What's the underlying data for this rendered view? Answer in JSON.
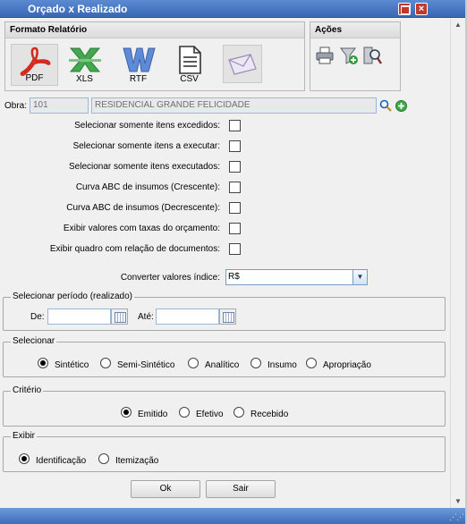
{
  "window": {
    "title": "Orçado x Realizado"
  },
  "format_panel": {
    "title": "Formato Relatório",
    "buttons": [
      {
        "label": "PDF",
        "icon": "pdf-icon"
      },
      {
        "label": "XLS",
        "icon": "excel-icon"
      },
      {
        "label": "RTF",
        "icon": "word-icon"
      },
      {
        "label": "CSV",
        "icon": "csv-file-icon"
      },
      {
        "label": "",
        "icon": "email-icon"
      }
    ]
  },
  "actions_panel": {
    "title": "Ações",
    "icons": [
      "printer-icon",
      "add-filter-icon",
      "search-preview-icon"
    ]
  },
  "obra": {
    "label": "Obra:",
    "code": "101",
    "name": "RESIDENCIAL GRANDE FELICIDADE"
  },
  "options": [
    "Selecionar somente itens excedidos:",
    "Selecionar somente itens a executar:",
    "Selecionar somente itens executados:",
    "Curva ABC de insumos (Crescente):",
    "Curva ABC de insumos (Decrescente):",
    "Exibir valores com taxas do orçamento:",
    "Exibir quadro com relação de documentos:"
  ],
  "converter": {
    "label": "Converter valores índice:",
    "value": "R$"
  },
  "periodo": {
    "legend": "Selecionar período (realizado)",
    "de_label": "De:",
    "ate_label": "Até:",
    "de_value": "",
    "ate_value": ""
  },
  "selecionar": {
    "legend": "Selecionar",
    "options": [
      "Sintético",
      "Semi-Sintético",
      "Analítico",
      "Insumo",
      "Apropriação"
    ],
    "selected": "Sintético"
  },
  "criterio": {
    "legend": "Critério",
    "options": [
      "Emitido",
      "Efetivo",
      "Recebido"
    ],
    "selected": "Emitido"
  },
  "exibir": {
    "legend": "Exibir",
    "options": [
      "Identificação",
      "Itemização"
    ],
    "selected": "Identificação"
  },
  "buttons": {
    "ok": "Ok",
    "sair": "Sair"
  },
  "colors": {
    "titlebar": "#4a78c4",
    "pdf_red": "#d42a1e",
    "excel_green": "#3aa64a",
    "word_blue": "#4f7fd0"
  }
}
